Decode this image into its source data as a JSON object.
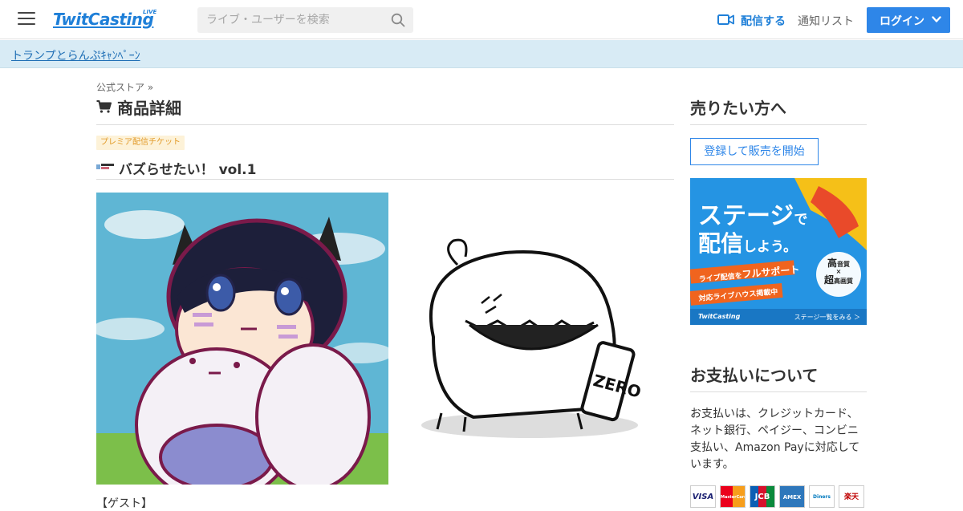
{
  "header": {
    "logo_text": "TwitCasting",
    "logo_badge": "LIVE",
    "search_placeholder": "ライブ・ユーザーを検索",
    "broadcast_label": "配信する",
    "notify_label": "通知リスト",
    "login_label": "ログイン"
  },
  "campaign": {
    "link_text": "トランプとらんぷｷｬﾝﾍﾟｰﾝ"
  },
  "main": {
    "breadcrumb": "公式ストア »",
    "page_title": "商品詳細",
    "tag": "プレミア配信チケット",
    "product_title": "バズらせたい！ vol.1",
    "guest_label": "【ゲスト】"
  },
  "sidebar": {
    "sell_title": "売りたい方へ",
    "register_button": "登録して販売を開始",
    "ad": {
      "line1_big": "ステージ",
      "line1_small": "で",
      "line2_big": "配信",
      "line2_small": "しよう。",
      "ribbon1_a": "ライブ配信を",
      "ribbon1_b": "フルサポート",
      "ribbon2": "対応ライブハウス掲載中",
      "badge_top": "高",
      "badge_top_small": "音質",
      "badge_mid": "×",
      "badge_bottom": "超",
      "badge_bottom_small": "高画質",
      "footer_logo": "TwitCasting",
      "footer_link": "ステージ一覧をみる ＞"
    },
    "payment_title": "お支払いについて",
    "payment_text": "お支払いは、クレジットカード、ネット銀行、ペイジー、コンビニ支払い、Amazon Payに対応しています。",
    "payment_logos": [
      "VISA",
      "MasterCard",
      "JCB",
      "AMEX",
      "Diners",
      "楽天"
    ]
  },
  "colors": {
    "accent": "#2e86e8",
    "brand": "#1e7fd8",
    "campaign_bg": "#d8ebf5",
    "tag_bg": "#fdf2d8",
    "tag_text": "#e29b2a"
  }
}
